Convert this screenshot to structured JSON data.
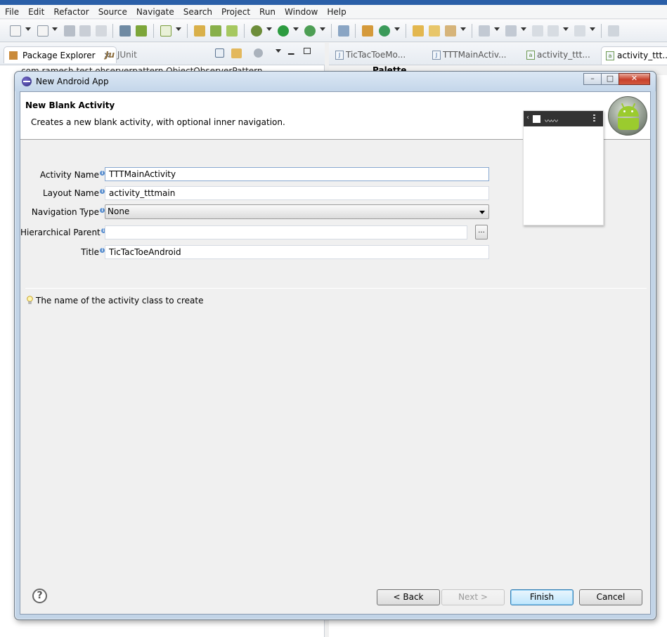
{
  "menubar": {
    "items": [
      "File",
      "Edit",
      "Refactor",
      "Source",
      "Navigate",
      "Search",
      "Project",
      "Run",
      "Window",
      "Help"
    ]
  },
  "left_panel": {
    "tabs": [
      {
        "label": "Package Explorer",
        "icon": "package-explorer-icon"
      },
      {
        "label": "JUnit",
        "icon": "junit-icon"
      }
    ],
    "tree_partial": "com.ramesh.test.observerpattern.ObjectObserverPattern"
  },
  "editor": {
    "tabs": [
      {
        "label": "TicTacToeMo...",
        "icon": "java-file-icon",
        "glyph": "J"
      },
      {
        "label": "TTTMainActiv...",
        "icon": "java-file-icon",
        "glyph": "J"
      },
      {
        "label": "activity_ttt...",
        "icon": "xml-layout-file-icon",
        "glyph": "a"
      },
      {
        "label": "activity_ttt...",
        "icon": "xml-layout-file-icon",
        "glyph": "a"
      }
    ],
    "palette_label": "Palette"
  },
  "dialog": {
    "window_title": "New Android App",
    "window_buttons": {
      "minimize": "–",
      "maximize": "□",
      "close": "✕"
    },
    "banner": {
      "title": "New Blank Activity",
      "description": "Creates a new blank activity, with optional inner navigation.",
      "icon": "android-robot-icon"
    },
    "form": {
      "activity_name": {
        "label": "Activity Name",
        "value": "TTTMainActivity"
      },
      "layout_name": {
        "label": "Layout Name",
        "value": "activity_tttmain"
      },
      "navigation_type": {
        "label": "Navigation Type",
        "value": "None"
      },
      "hierarchical_parent": {
        "label": "Hierarchical Parent",
        "value": "",
        "browse_label": "..."
      },
      "title": {
        "label": "Title",
        "value": "TicTacToeAndroid"
      }
    },
    "hint": "The name of the activity class to create",
    "buttons": {
      "back": "< Back",
      "next": "Next >",
      "finish": "Finish",
      "cancel": "Cancel",
      "help": "?"
    }
  },
  "colors": {
    "dialog_frame": "#c2d4e7",
    "dialog_body": "#f0f0f0",
    "close_button": "#c7412c",
    "default_button": "#bee6fd",
    "android_green": "#9bcb2e"
  }
}
